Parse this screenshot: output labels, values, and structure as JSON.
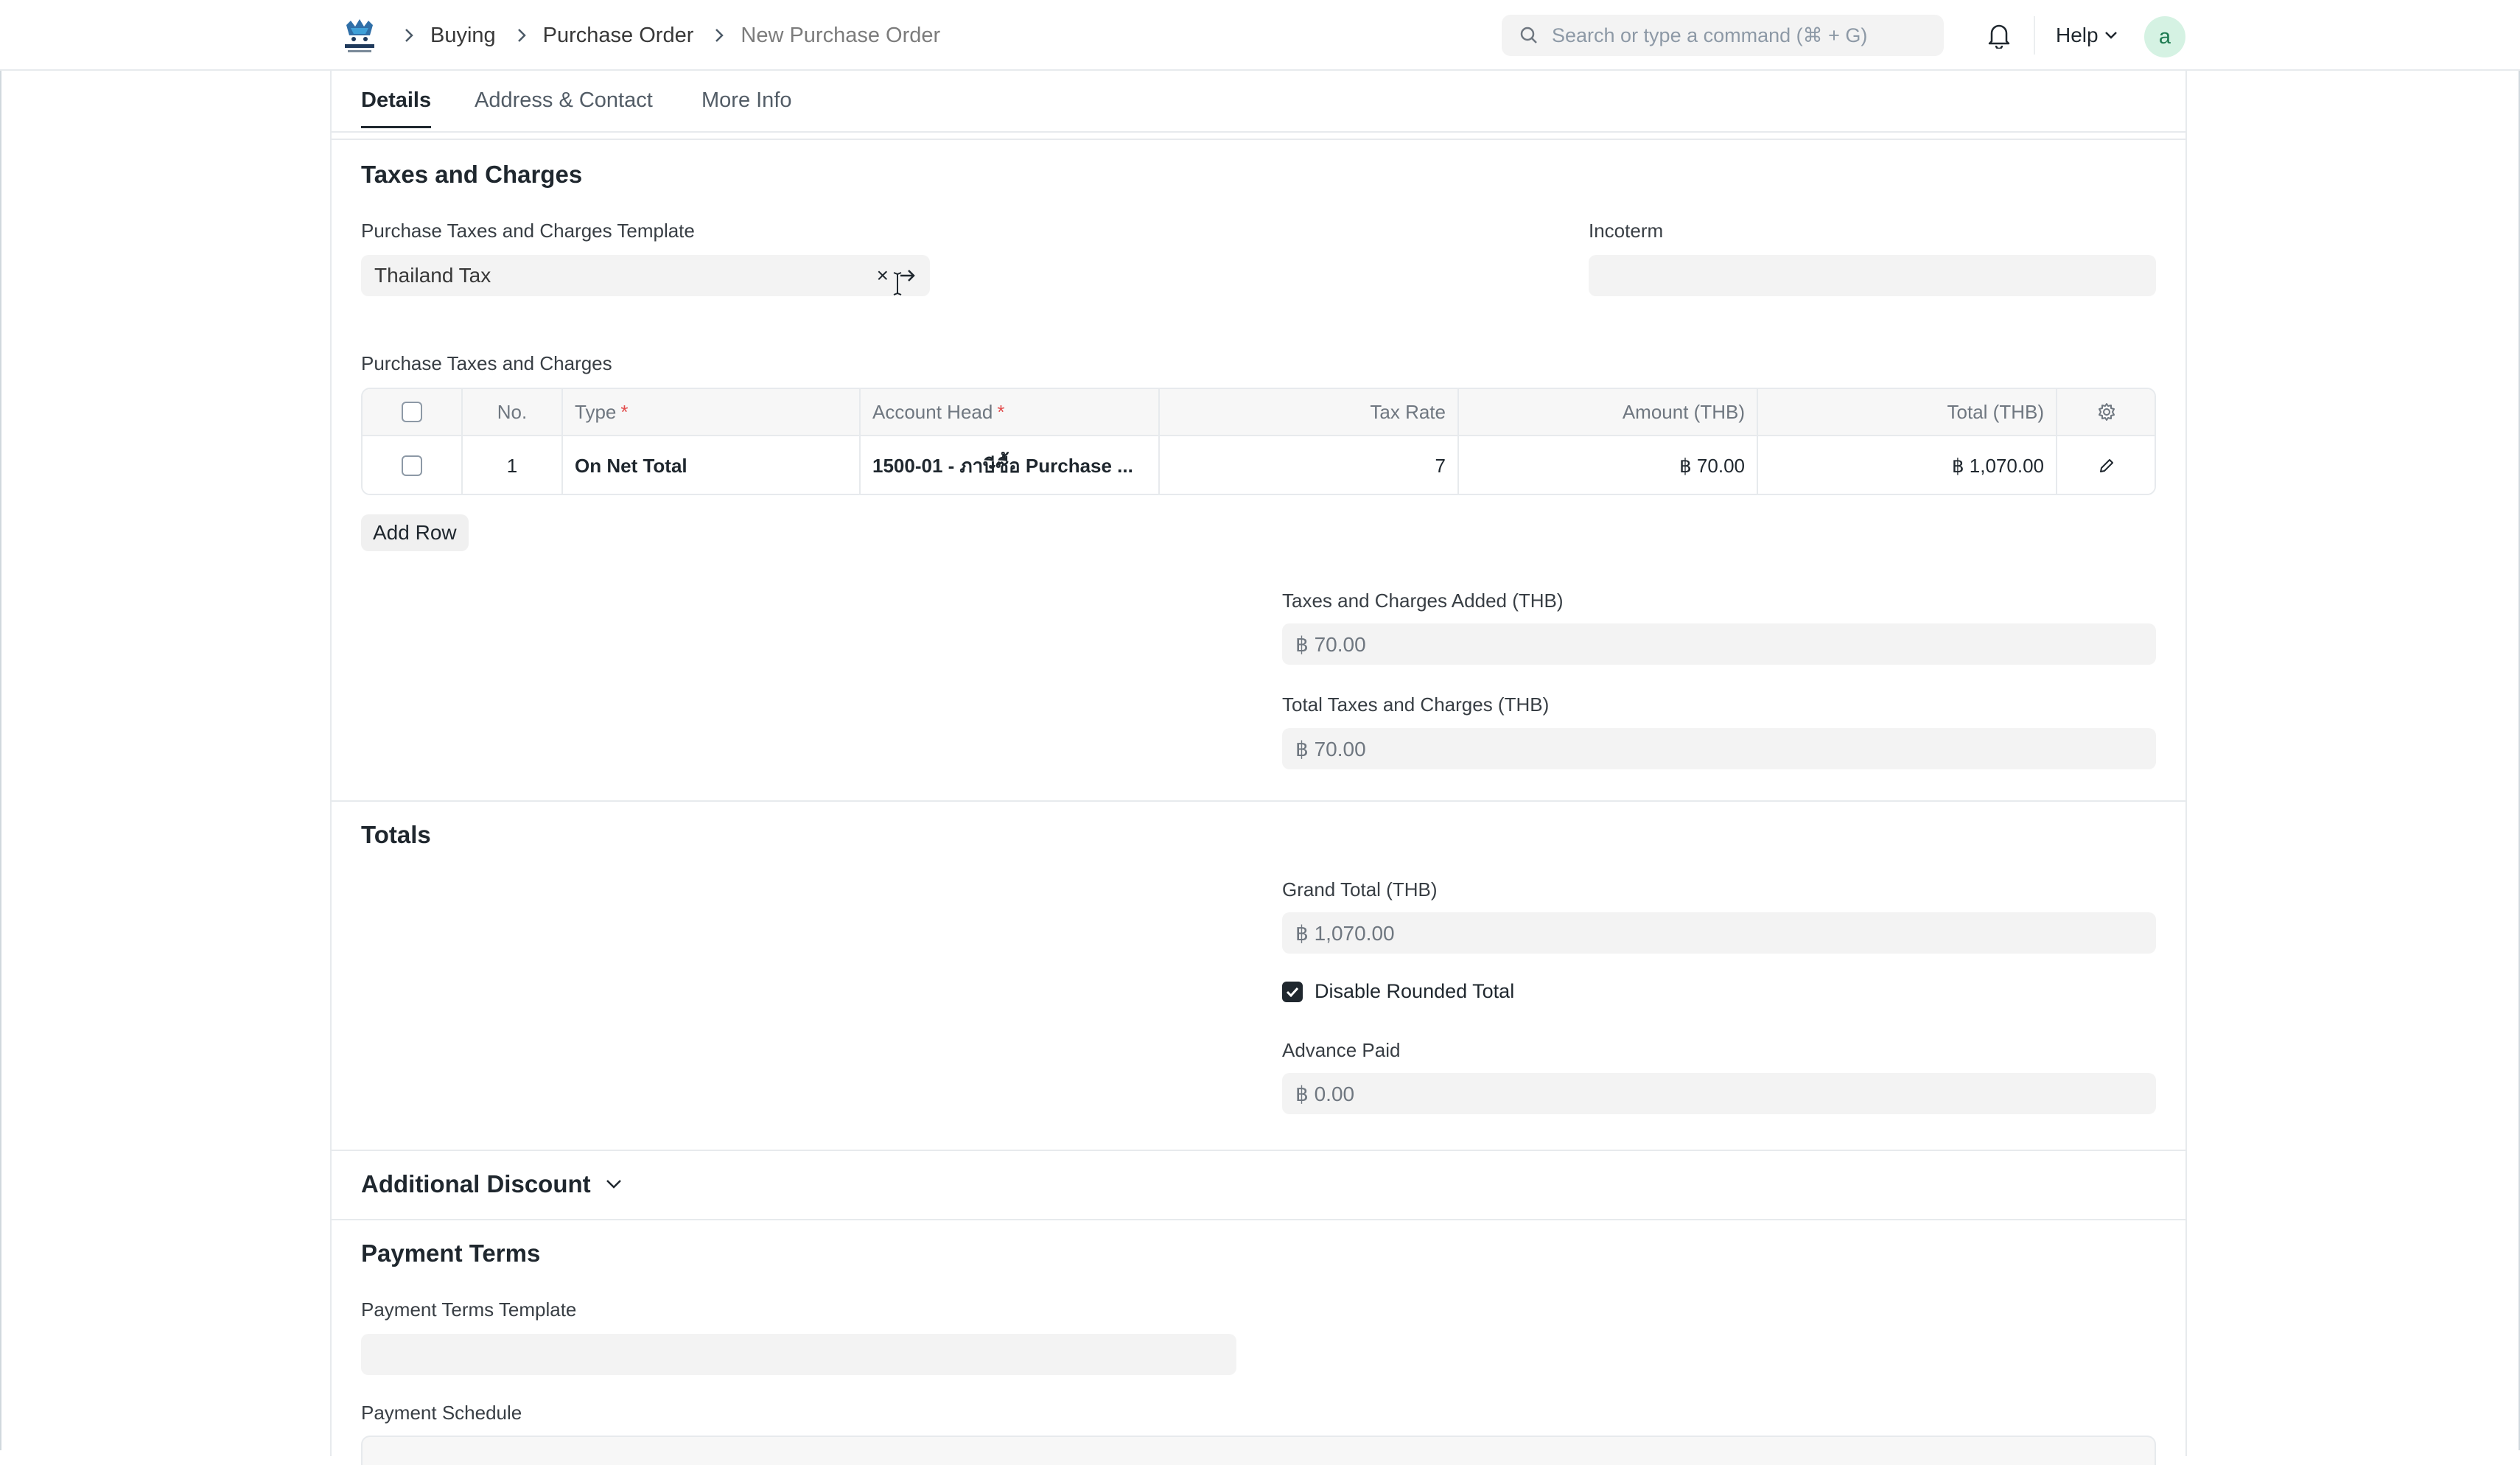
{
  "navbar": {
    "breadcrumbs": [
      "Buying",
      "Purchase Order",
      "New Purchase Order"
    ],
    "search_placeholder": "Search or type a command (⌘ + G)",
    "help_label": "Help",
    "avatar_initial": "a"
  },
  "tabs": [
    {
      "label": "Details",
      "active": true
    },
    {
      "label": "Address & Contact",
      "active": false
    },
    {
      "label": "More Info",
      "active": false
    }
  ],
  "taxes": {
    "section_title": "Taxes and Charges",
    "template_label": "Purchase Taxes and Charges Template",
    "template_value": "Thailand Tax",
    "incoterm_label": "Incoterm",
    "incoterm_value": "",
    "table_label": "Purchase Taxes and Charges",
    "columns": [
      "No.",
      "Type",
      "Account Head",
      "Tax Rate",
      "Amount (THB)",
      "Total (THB)"
    ],
    "rows": [
      {
        "no": "1",
        "type": "On Net Total",
        "account_head": "1500-01 - ภาษีซื้อ Purchase ...",
        "tax_rate": "7",
        "amount": "฿ 70.00",
        "total": "฿ 1,070.00"
      }
    ],
    "add_row_label": "Add Row",
    "added_label": "Taxes and Charges Added (THB)",
    "added_value": "฿ 70.00",
    "total_label": "Total Taxes and Charges (THB)",
    "total_value": "฿ 70.00"
  },
  "totals": {
    "section_title": "Totals",
    "grand_total_label": "Grand Total (THB)",
    "grand_total_value": "฿ 1,070.00",
    "disable_rounded_label": "Disable Rounded Total",
    "disable_rounded_checked": true,
    "advance_paid_label": "Advance Paid",
    "advance_paid_value": "฿ 0.00"
  },
  "additional_discount": {
    "title": "Additional Discount"
  },
  "payment_terms": {
    "section_title": "Payment Terms",
    "template_label": "Payment Terms Template",
    "template_value": "",
    "schedule_label": "Payment Schedule"
  },
  "colors": {
    "accent": "#1f272e",
    "required": "#e24c4c",
    "field_bg": "#f3f3f3",
    "border": "#e7eaed"
  }
}
